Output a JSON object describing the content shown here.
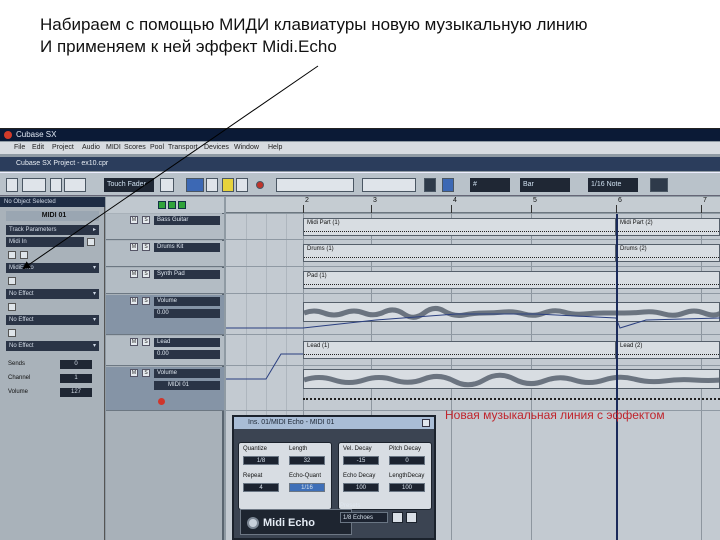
{
  "caption": {
    "line1": "Набираем с помощью МИДИ клавиатуры новую музыкальную линию",
    "line2": "И применяем к ней эффект Midi.Echo"
  },
  "app": {
    "title": "Cubase SX",
    "project_title": "Cubase SX Project - ex10.cpr",
    "menu": [
      "File",
      "Edit",
      "Project",
      "Audio",
      "MIDI",
      "Scores",
      "Pool",
      "Transport",
      "Devices",
      "Window",
      "Help"
    ],
    "toolbar": {
      "mode_field": "Touch Fader",
      "snap_field": "Bar",
      "quantize_field": "1/16 Note"
    }
  },
  "inspector": {
    "header": "No Object Selected",
    "track_title": "MIDI 01",
    "rows": [
      {
        "label": "Track Parameters",
        "arrow": "▸"
      },
      {
        "label": "Midi In",
        "arrow": ""
      },
      {
        "label": "MidiEcho",
        "arrow": "▾"
      },
      {
        "label": "No Effect",
        "arrow": "▾"
      },
      {
        "label": "No Effect",
        "arrow": "▾"
      },
      {
        "label": "No Effect",
        "arrow": "▾"
      }
    ],
    "params": [
      {
        "label": "Sends",
        "value": "0"
      },
      {
        "label": "Channel",
        "value": "1"
      },
      {
        "label": "Volume",
        "value": "127"
      }
    ]
  },
  "tracks": [
    {
      "name": "Bass Guitar",
      "name2": ""
    },
    {
      "name": "Drums Kit",
      "name2": ""
    },
    {
      "name": "Synth Pad",
      "name2": ""
    },
    {
      "name": "Volume",
      "name2": "0.00"
    },
    {
      "name": "Lead",
      "name2": "0.00"
    },
    {
      "name": "Volume",
      "name2": "MIDI 01"
    }
  ],
  "ruler": {
    "numbers": [
      "2",
      "3",
      "4",
      "5",
      "6",
      "7"
    ]
  },
  "parts": [
    {
      "row": 0,
      "label": "Midi Part (1)"
    },
    {
      "row": 0,
      "label": "Midi Part (2)"
    },
    {
      "row": 1,
      "label": "Drums (1)"
    },
    {
      "row": 1,
      "label": "Drums (2)"
    },
    {
      "row": 2,
      "label": "Pad (1)"
    },
    {
      "row": 4,
      "label": "Lead (1)"
    },
    {
      "row": 4,
      "label": "Lead (2)"
    }
  ],
  "new_line_label": "Новая музыкальная линия с эффектом",
  "plugin": {
    "title": "Ins. 01/MIDI Echo - MIDI 01",
    "brand": "Midi Echo",
    "knobs": [
      {
        "label": "Quantize",
        "value": "1/8"
      },
      {
        "label": "Length",
        "value": "32"
      },
      {
        "label": "Repeat",
        "value": "4"
      },
      {
        "label": "Echo-Quant",
        "value": "1/16"
      },
      {
        "label": "Vel. Decay",
        "value": "-15"
      },
      {
        "label": "Pitch Decay",
        "value": "0"
      },
      {
        "label": "Echo Decay",
        "value": "100"
      },
      {
        "label": "LengthDecay",
        "value": "100"
      }
    ],
    "preset_label": "Presets",
    "preset_value": "1/8 Echoes"
  },
  "colors": {
    "accent": "#c0242c",
    "selection": "#3e6fb8",
    "record": "#d0362c"
  }
}
